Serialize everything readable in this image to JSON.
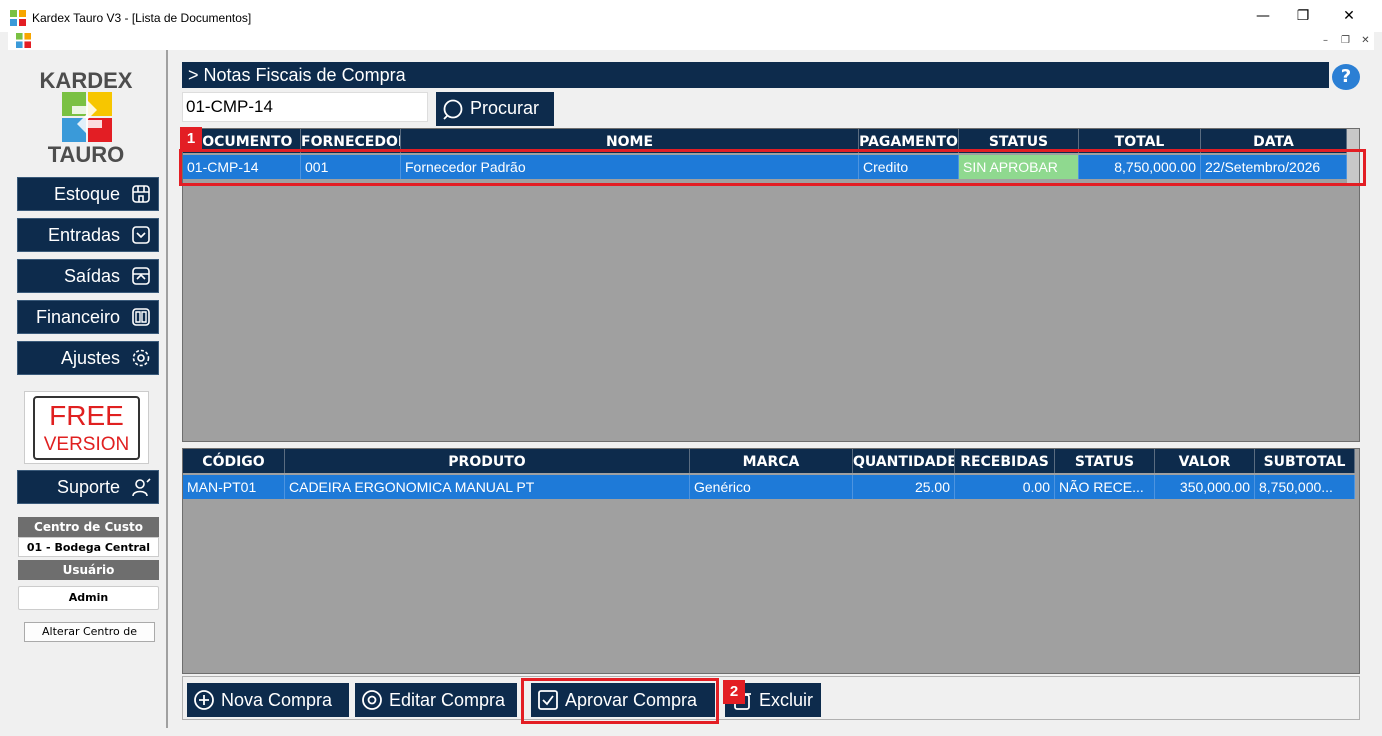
{
  "window": {
    "title": "Kardex Tauro V3 - [Lista de Documentos]",
    "controls": [
      "minimize-icon",
      "restore-icon",
      "close-icon"
    ]
  },
  "sidebar": {
    "logo_top": "KARDEX",
    "logo_bottom": "TAURO",
    "nav": [
      {
        "label": "Estoque",
        "icon": "store-icon"
      },
      {
        "label": "Entradas",
        "icon": "inbox-in-icon"
      },
      {
        "label": "Saídas",
        "icon": "inbox-out-icon"
      },
      {
        "label": "Financeiro",
        "icon": "book-icon"
      },
      {
        "label": "Ajustes",
        "icon": "gear-icon"
      }
    ],
    "free_line1": "FREE",
    "free_line2": "VERSION",
    "support_label": "Suporte",
    "cost_center_header": "Centro de Custo",
    "cost_center_value": "01 - Bodega Central",
    "user_header": "Usuário",
    "user_value": "Admin",
    "change_cc_button": "Alterar Centro de"
  },
  "main": {
    "header": "> Notas Fiscais de Compra",
    "search_value": "01-CMP-14",
    "search_button": "Procurar",
    "documents": {
      "columns": [
        "DOCUMENTO",
        "FORNECEDOR",
        "NOME",
        "PAGAMENTO",
        "STATUS",
        "TOTAL",
        "DATA"
      ],
      "rows": [
        {
          "documento": "01-CMP-14",
          "fornecedor": "001",
          "nome": "Fornecedor Padrão",
          "pagamento": "Credito",
          "status": "SIN APROBAR",
          "total": "8,750,000.00",
          "data": "22/Setembro/2026"
        }
      ]
    },
    "items": {
      "columns": [
        "CÓDIGO",
        "PRODUTO",
        "MARCA",
        "QUANTIDADE",
        "RECEBIDAS",
        "STATUS",
        "VALOR",
        "SUBTOTAL"
      ],
      "rows": [
        {
          "codigo": "MAN-PT01",
          "produto": "CADEIRA ERGONOMICA MANUAL PT",
          "marca": "Genérico",
          "quantidade": "25.00",
          "recebidas": "0.00",
          "status": "NÃO RECE...",
          "valor": "350,000.00",
          "subtotal": "8,750,000..."
        }
      ]
    },
    "toolbar": {
      "new_label": "Nova Compra",
      "edit_label": "Editar Compra",
      "approve_label": "Aprovar Compra",
      "delete_label": "Excluir"
    },
    "annotations": {
      "marker1": "1",
      "marker2": "2"
    }
  },
  "colors": {
    "navy": "#0d2b4c",
    "selection": "#1e7ad8",
    "status_green": "#8fd98f",
    "marker_red": "#e31e24"
  }
}
